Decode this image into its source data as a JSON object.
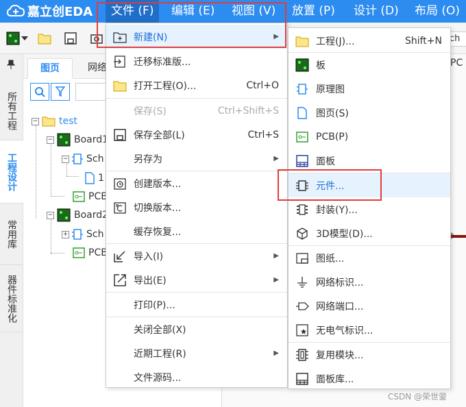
{
  "app": {
    "logo_text": "嘉立创EDA"
  },
  "menubar": {
    "items": [
      {
        "label": "文件 (F)"
      },
      {
        "label": "编辑 (E)"
      },
      {
        "label": "视图 (V)"
      },
      {
        "label": "放置 (P)"
      },
      {
        "label": "设计 (D)"
      },
      {
        "label": "布局 (O)"
      }
    ]
  },
  "toolbar": {
    "search_text": "ch"
  },
  "left_strip": {
    "tabs": [
      {
        "label": "所有工程"
      },
      {
        "label": "工程设计"
      },
      {
        "label": "常用库"
      },
      {
        "label": "器件标准化"
      }
    ]
  },
  "panel": {
    "tabs": [
      {
        "label": "图页"
      },
      {
        "label": "网络"
      }
    ],
    "tree": [
      {
        "label": "test"
      },
      {
        "label": "Board1"
      },
      {
        "label": "Sch"
      },
      {
        "label": "1"
      },
      {
        "label": "PCB"
      },
      {
        "label": "Board2"
      },
      {
        "label": "Sch"
      },
      {
        "label": "PCB"
      }
    ]
  },
  "canvas": {
    "tab_label": "PC"
  },
  "file_menu": {
    "items": [
      {
        "label": "新建(N)",
        "shortcut": ""
      },
      {
        "label": "迁移标准版...",
        "shortcut": ""
      },
      {
        "label": "打开工程(O)...",
        "shortcut": "Ctrl+O"
      },
      {
        "label": "保存(S)",
        "shortcut": "Ctrl+Shift+S"
      },
      {
        "label": "保存全部(L)",
        "shortcut": "Ctrl+S"
      },
      {
        "label": "另存为",
        "shortcut": ""
      },
      {
        "label": "创建版本...",
        "shortcut": ""
      },
      {
        "label": "切换版本...",
        "shortcut": ""
      },
      {
        "label": "缓存恢复...",
        "shortcut": ""
      },
      {
        "label": "导入(I)",
        "shortcut": ""
      },
      {
        "label": "导出(E)",
        "shortcut": ""
      },
      {
        "label": "打印(P)...",
        "shortcut": ""
      },
      {
        "label": "关闭全部(X)",
        "shortcut": ""
      },
      {
        "label": "近期工程(R)",
        "shortcut": ""
      },
      {
        "label": "文件源码...",
        "shortcut": ""
      }
    ]
  },
  "new_submenu": {
    "items": [
      {
        "label": "工程(J)...",
        "shortcut": "Shift+N"
      },
      {
        "label": "板"
      },
      {
        "label": "原理图"
      },
      {
        "label": "图页(S)"
      },
      {
        "label": "PCB(P)"
      },
      {
        "label": "面板"
      },
      {
        "label": "元件..."
      },
      {
        "label": "封装(Y)..."
      },
      {
        "label": "3D模型(D)..."
      },
      {
        "label": "图纸..."
      },
      {
        "label": "网络标识..."
      },
      {
        "label": "网络端口..."
      },
      {
        "label": "无电气标识..."
      },
      {
        "label": "复用模块..."
      },
      {
        "label": "面板库..."
      }
    ]
  },
  "watermark": "CSDN @荣世蓥",
  "colors": {
    "accent": "#2d8cf0",
    "highlight_box": "#e03c3c"
  }
}
